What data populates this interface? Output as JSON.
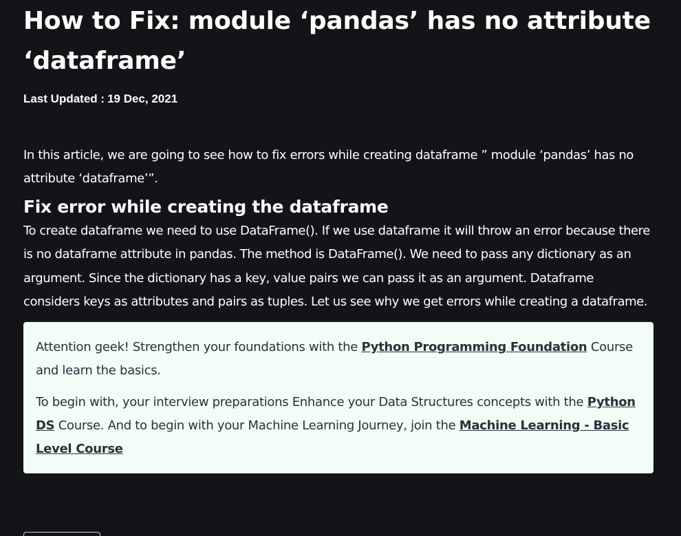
{
  "article": {
    "title": "How to Fix: module ‘pandas’ has no attribute ‘dataframe’",
    "last_updated_label": "Last Updated :",
    "last_updated_date": "19 Dec, 2021",
    "intro": "In this article, we are going to see how to fix errors while creating dataframe ” module ‘pandas’ has no attribute ‘dataframe’”.",
    "section_heading": "Fix error while creating the dataframe",
    "section_body": "To create dataframe we need to use DataFrame(). If we use dataframe it will throw an error because there is no dataframe attribute in pandas. The method is DataFrame(). We need to pass any dictionary as an argument. Since the dictionary has a key, value pairs we can pass it as an argument. Dataframe considers keys as attributes and pairs as tuples. Let us see why we get errors while creating a dataframe."
  },
  "promo": {
    "p1_prefix": " Attention geek! Strengthen your foundations with the ",
    "p1_link": "Python Programming Foundation",
    "p1_suffix": " Course and learn the basics.",
    "p2_prefix": "To begin with, your interview preparations Enhance your Data Structures concepts with the ",
    "p2_link1": "Python DS",
    "p2_middle": " Course. And to begin with your Machine Learning Journey, join the ",
    "p2_link2": "Machine Learning - Basic Level Course"
  },
  "colors": {
    "page_background": "#131417",
    "text": "#ffffff",
    "promo_background": "#f1fdf6",
    "promo_text": "#273239"
  }
}
